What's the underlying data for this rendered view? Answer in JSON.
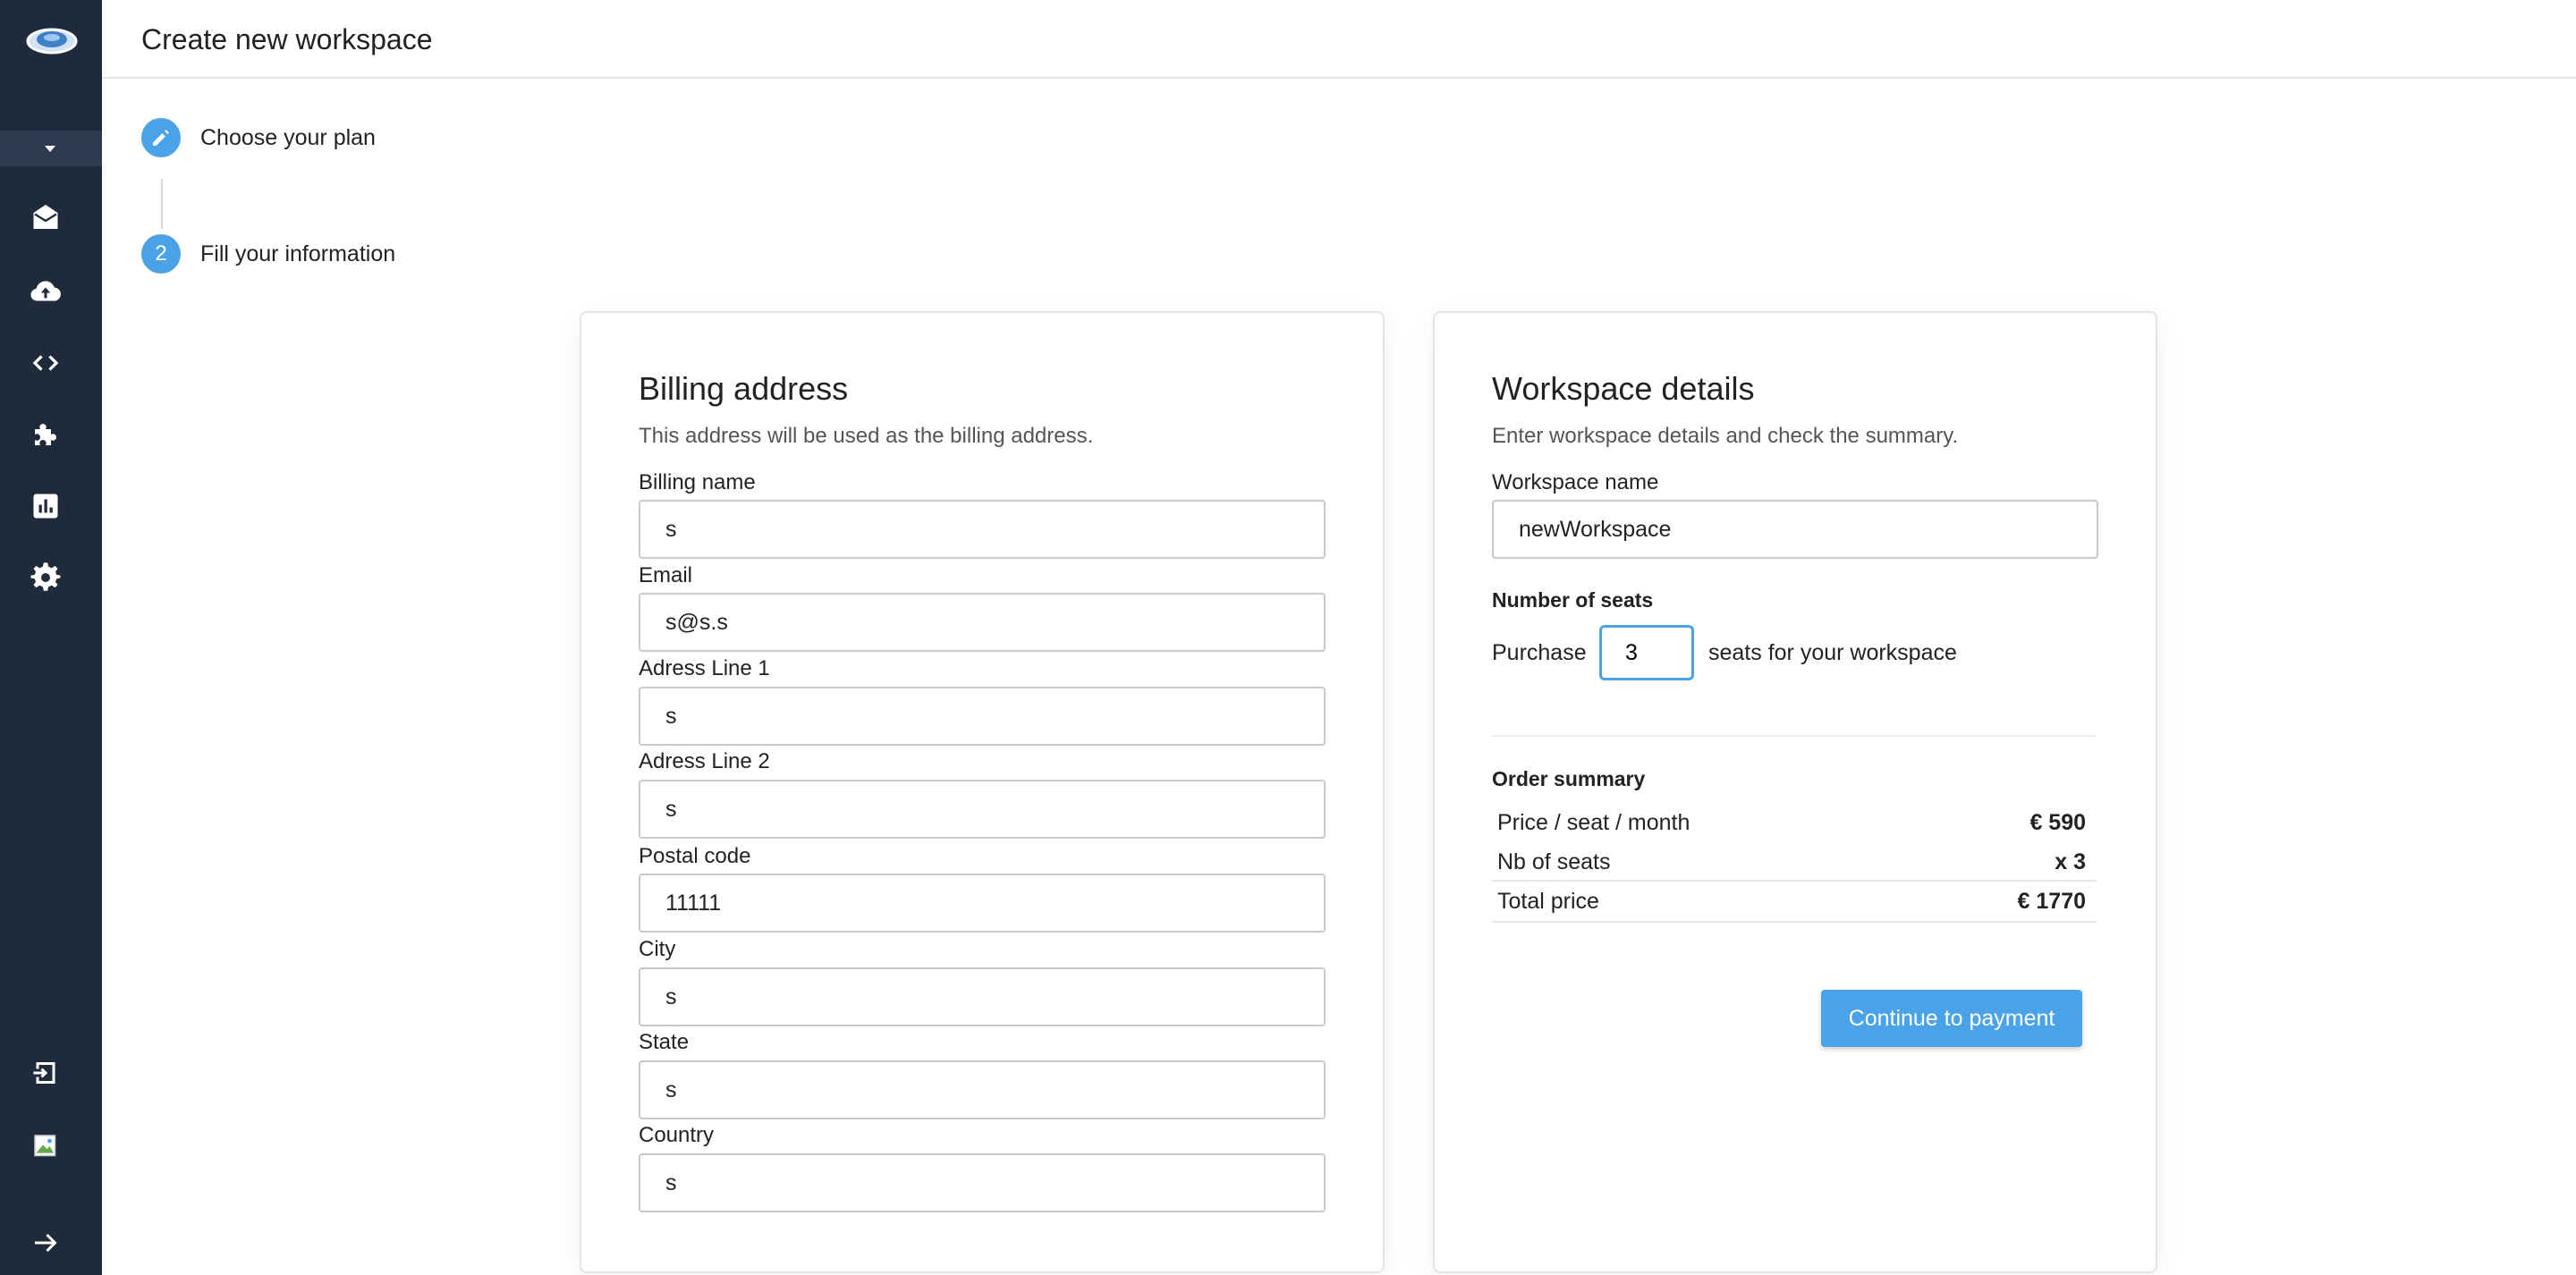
{
  "header": {
    "title": "Create new workspace"
  },
  "stepper": {
    "steps": [
      {
        "label": "Choose your plan",
        "state": "editing"
      },
      {
        "label": "Fill your information",
        "number": "2"
      }
    ]
  },
  "sidebar": {
    "items": [
      {
        "icon": "envelope-open-icon"
      },
      {
        "icon": "cloud-upload-icon"
      },
      {
        "icon": "code-icon"
      },
      {
        "icon": "puzzle-icon"
      },
      {
        "icon": "bar-chart-icon"
      },
      {
        "icon": "gear-icon"
      }
    ],
    "bottom": [
      {
        "icon": "logout-icon"
      },
      {
        "icon": "avatar-image-icon"
      },
      {
        "icon": "arrow-right-icon"
      }
    ]
  },
  "billing": {
    "title": "Billing address",
    "subtitle": "This address will be used as the billing address.",
    "fields": [
      {
        "label": "Billing name",
        "value": "s"
      },
      {
        "label": "Email",
        "value": "s@s.s"
      },
      {
        "label": "Adress Line 1",
        "value": "s"
      },
      {
        "label": "Adress Line 2",
        "value": "s"
      },
      {
        "label": "Postal code",
        "value": "11111"
      },
      {
        "label": "City",
        "value": "s"
      },
      {
        "label": "State",
        "value": "s"
      },
      {
        "label": "Country",
        "value": "s"
      }
    ]
  },
  "workspace": {
    "title": "Workspace details",
    "subtitle": "Enter workspace details and check the summary.",
    "name_label": "Workspace name",
    "name_value": "newWorkspace",
    "seats_label": "Number of seats",
    "purchase_prefix": "Purchase",
    "seats_value": "3",
    "purchase_suffix": "seats for your workspace",
    "order_title": "Order summary",
    "order_rows": [
      {
        "label": "Price / seat / month",
        "value": "€ 590"
      },
      {
        "label": "Nb of seats",
        "value": "x 3"
      },
      {
        "label": "Total price",
        "value": "€ 1770"
      }
    ],
    "continue_label": "Continue to payment"
  },
  "colors": {
    "accent": "#4aa3e8",
    "sidebar": "#1f2a3a"
  }
}
